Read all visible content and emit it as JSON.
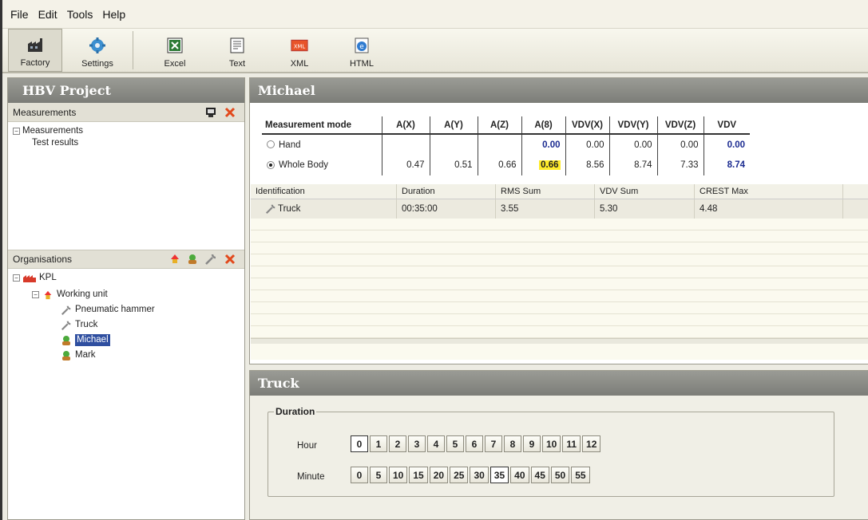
{
  "menu": [
    "File",
    "Edit",
    "Tools",
    "Help"
  ],
  "toolbar": [
    {
      "label": "Factory",
      "icon": "factory-icon"
    },
    {
      "label": "Settings",
      "icon": "settings-icon"
    },
    {
      "label": "Excel",
      "icon": "excel-icon"
    },
    {
      "label": "Text",
      "icon": "text-icon"
    },
    {
      "label": "XML",
      "icon": "xml-icon"
    },
    {
      "label": "HTML",
      "icon": "html-icon"
    }
  ],
  "left": {
    "title": "HBV Project",
    "measurements_label": "Measurements",
    "measurements_tree": {
      "root": "Measurements",
      "child": "Test results"
    },
    "organisations_label": "Organisations",
    "org_tree": {
      "root": "KPL",
      "unit": "Working unit",
      "items": [
        "Pneumatic hammer",
        "Truck",
        "Michael",
        "Mark"
      ]
    }
  },
  "right": {
    "title": "Michael",
    "table": {
      "headers": [
        "Measurement mode",
        "A(X)",
        "A(Y)",
        "A(Z)",
        "A(8)",
        "VDV(X)",
        "VDV(Y)",
        "VDV(Z)",
        "VDV"
      ],
      "rows": [
        {
          "mode": "Hand",
          "selected": false,
          "values": [
            "",
            "",
            "",
            "0.00",
            "0.00",
            "0.00",
            "0.00",
            "0.00"
          ]
        },
        {
          "mode": "Whole Body",
          "selected": true,
          "values": [
            "0.47",
            "0.51",
            "0.66",
            "0.66",
            "8.56",
            "8.74",
            "7.33",
            "8.74"
          ]
        }
      ]
    },
    "grid": {
      "headers": [
        "Identification",
        "Duration",
        "RMS Sum",
        "VDV Sum",
        "CREST Max"
      ],
      "rows": [
        [
          "Truck",
          "00:35:00",
          "3.55",
          "5.30",
          "4.48"
        ]
      ]
    }
  },
  "truck": {
    "title": "Truck",
    "legend": "Duration",
    "hour_label": "Hour",
    "minute_label": "Minute",
    "hours": [
      "0",
      "1",
      "2",
      "3",
      "4",
      "5",
      "6",
      "7",
      "8",
      "9",
      "10",
      "11",
      "12"
    ],
    "minutes": [
      "0",
      "5",
      "10",
      "15",
      "20",
      "25",
      "30",
      "35",
      "40",
      "45",
      "50",
      "55"
    ],
    "selected_hour": "0",
    "selected_minute": "35"
  },
  "colors": {
    "title_bar": "#8a8b86",
    "selection": "#2f4fa0",
    "highlight": "#ffeb2a",
    "value_blue": "#1a2a90"
  }
}
